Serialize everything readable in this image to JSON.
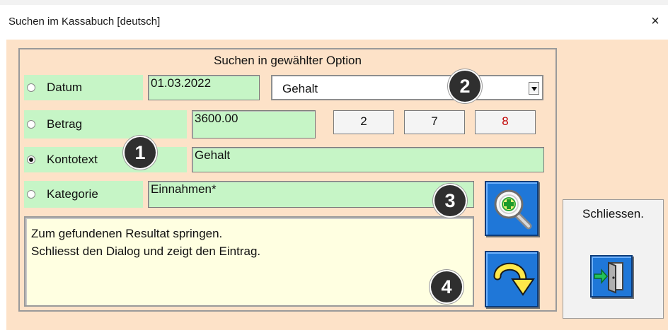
{
  "window": {
    "title": "Suchen im Kassabuch [deutsch]",
    "close_label": "×"
  },
  "frame": {
    "title": "Suchen in gewählter Option"
  },
  "options": {
    "datum": {
      "label": "Datum",
      "value": "01.03.2022",
      "selected": false
    },
    "betrag": {
      "label": "Betrag",
      "value": "3600.00",
      "selected": false
    },
    "kontotext": {
      "label": "Kontotext",
      "value": "Gehalt",
      "selected": true
    },
    "kategorie": {
      "label": "Kategorie",
      "value": "Einnahmen*",
      "selected": false
    }
  },
  "combo": {
    "selected": "Gehalt"
  },
  "counters": [
    {
      "value": "2",
      "color": "#111111"
    },
    {
      "value": "7",
      "color": "#111111"
    },
    {
      "value": "8",
      "color": "#c00000"
    }
  ],
  "badges": {
    "one": "1",
    "two": "2",
    "three": "3",
    "four": "4"
  },
  "info": {
    "line1": "Zum gefundenen Resultat springen.",
    "line2": "Schliesst den Dialog und zeigt den Eintrag."
  },
  "close_panel": {
    "label": "Schliessen."
  },
  "icons": {
    "search": "magnifier-plus-icon",
    "jump": "curved-arrow-down-icon",
    "exit": "door-exit-icon"
  },
  "colors": {
    "background": "#fde2c8",
    "field_green": "#c6f5c6",
    "button_blue": "#1f77d8",
    "info_yellow": "#ffffe1"
  }
}
